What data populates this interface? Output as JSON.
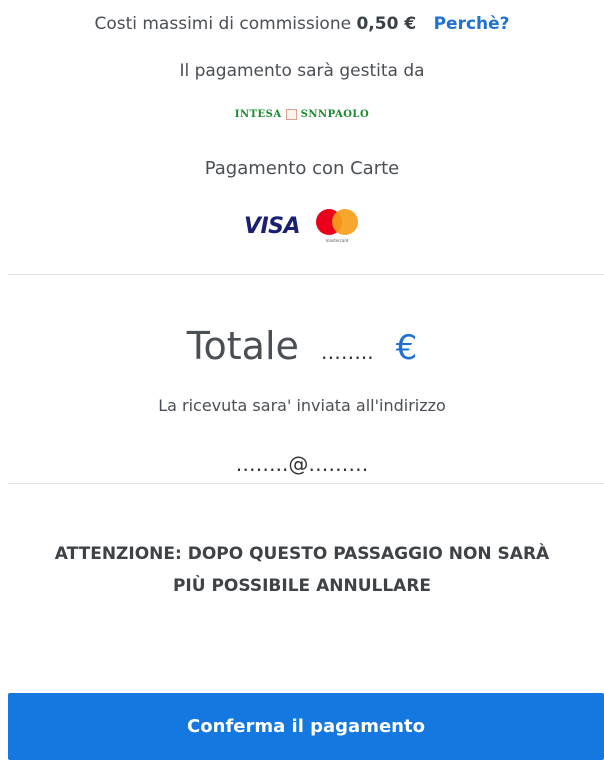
{
  "commission": {
    "label": "Costi massimi di commissione",
    "amount": "0,50 €",
    "why_link": "Perchè?"
  },
  "handler": {
    "label": "Il pagamento sarà gestita da",
    "bank_left": "INTESA",
    "bank_right": "SNNPAOLO"
  },
  "payment_method": {
    "label": "Pagamento con Carte",
    "cards": [
      "VISA",
      "mastercard"
    ]
  },
  "total": {
    "label": "Totale",
    "amount_masked": "……..",
    "currency": "€"
  },
  "receipt": {
    "label": "La ricevuta sara' inviata all'indirizzo",
    "email_masked": "……..@………"
  },
  "warning": {
    "line1": "ATTENZIONE: DOPO QUESTO PASSAGGIO NON SARÀ",
    "line2": "PIÙ POSSIBILE ANNULLARE"
  },
  "confirm_button": {
    "label": "Conferma il pagamento"
  },
  "colors": {
    "accent": "#1478e0",
    "link": "#1f72d3",
    "bank_green": "#1a8a2e"
  }
}
